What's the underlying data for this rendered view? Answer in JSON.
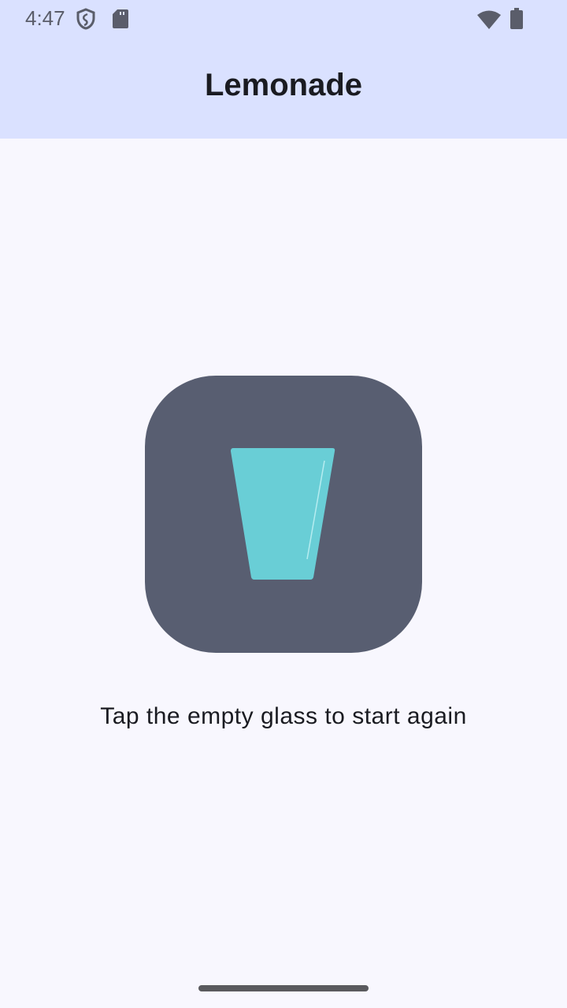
{
  "status_bar": {
    "time": "4:47",
    "icons": [
      "shield-icon",
      "sd-card-icon",
      "wifi-icon",
      "battery-icon"
    ]
  },
  "app_bar": {
    "title": "Lemonade"
  },
  "main": {
    "image": "empty-glass",
    "caption": "Tap the empty glass to start again"
  },
  "colors": {
    "app_bar": "#dae1ff",
    "image_bg": "#585e71",
    "glass": "#69ced6",
    "background": "#f8f7fe"
  }
}
